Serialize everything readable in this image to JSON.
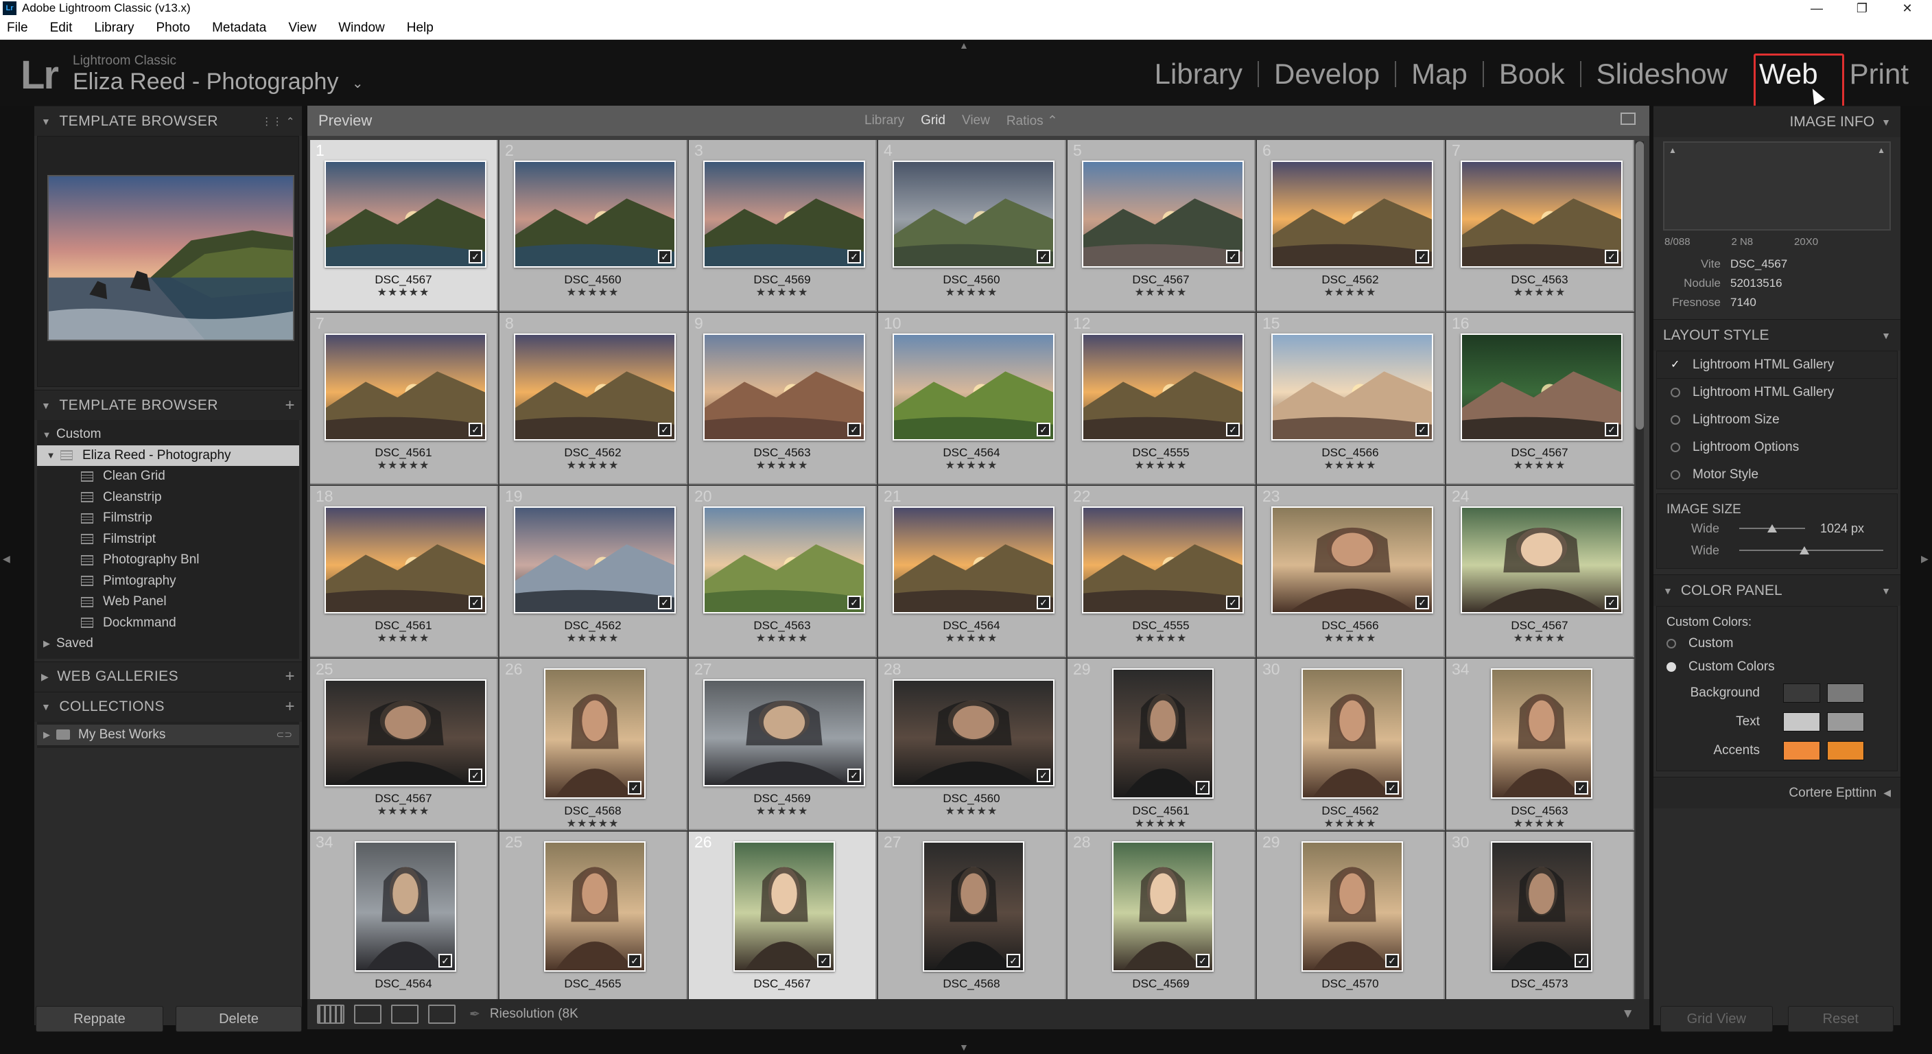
{
  "window": {
    "badge": "Lr",
    "title": "Adobe Lightroom Classic (v13.x)",
    "controls": [
      "—",
      "❐",
      "✕"
    ]
  },
  "menu": [
    "File",
    "Edit",
    "Library",
    "Photo",
    "Metadata",
    "View",
    "Window",
    "Help"
  ],
  "identity": {
    "logo": "Lr",
    "app": "Lightroom Classic",
    "catalog": "Eliza Reed - Photography"
  },
  "modules": [
    "Library",
    "Develop",
    "Map",
    "Book",
    "Slideshow",
    "Web",
    "Print"
  ],
  "active_module": "Web",
  "left_panel": {
    "preview_header": "TEMPLATE BROWSER",
    "template_header": "TEMPLATE BROWSER",
    "folders": [
      {
        "label": "Custom",
        "expanded": true
      },
      {
        "label": "Eliza Reed - Photography",
        "selected": true
      },
      {
        "label": "Clean Grid"
      },
      {
        "label": "Cleanstrip"
      },
      {
        "label": "Filmstrip"
      },
      {
        "label": "Filmstript"
      },
      {
        "label": "Photography Bnl"
      },
      {
        "label": "Pimtography"
      },
      {
        "label": "Web Panel"
      },
      {
        "label": "Dockmmand"
      },
      {
        "label": "Saved"
      }
    ],
    "web_galleries_header": "WEB GALLERIES",
    "collections_header": "COLLECTIONS",
    "collection_item": "My Best Works",
    "buttons": [
      "Reppate",
      "Delete"
    ]
  },
  "center": {
    "title": "Preview",
    "view_options": [
      "Library",
      "Grid",
      "View",
      "Ratios ⌃"
    ],
    "active_view": "Grid",
    "grid": [
      [
        {
          "num": "1",
          "name": "DSC_4567",
          "sel": true,
          "kind": "coast"
        },
        {
          "num": "2",
          "name": "DSC_4560",
          "kind": "coast"
        },
        {
          "num": "3",
          "name": "DSC_4569",
          "kind": "coast"
        },
        {
          "num": "4",
          "name": "DSC_4560",
          "kind": "mountain"
        },
        {
          "num": "5",
          "name": "DSC_4567",
          "kind": "peaks"
        },
        {
          "num": "6",
          "name": "DSC_4562",
          "kind": "sunset"
        },
        {
          "num": "7",
          "name": "DSC_4563",
          "kind": "sunset"
        }
      ],
      [
        {
          "num": "7",
          "name": "DSC_4561",
          "kind": "sunset"
        },
        {
          "num": "8",
          "name": "DSC_4562",
          "kind": "sunset"
        },
        {
          "num": "9",
          "name": "DSC_4563",
          "kind": "rocks"
        },
        {
          "num": "10",
          "name": "DSC_4564",
          "kind": "valley"
        },
        {
          "num": "12",
          "name": "DSC_4555",
          "kind": "sunset"
        },
        {
          "num": "15",
          "name": "DSC_4566",
          "kind": "beach"
        },
        {
          "num": "16",
          "name": "DSC_4567",
          "kind": "green"
        }
      ],
      [
        {
          "num": "18",
          "name": "DSC_4561",
          "kind": "sunset"
        },
        {
          "num": "19",
          "name": "DSC_4562",
          "kind": "lake"
        },
        {
          "num": "20",
          "name": "DSC_4563",
          "kind": "hills"
        },
        {
          "num": "21",
          "name": "DSC_4564",
          "kind": "sunset"
        },
        {
          "num": "22",
          "name": "DSC_4555",
          "kind": "sunset"
        },
        {
          "num": "23",
          "name": "DSC_4566",
          "kind": "portrait-warm"
        },
        {
          "num": "24",
          "name": "DSC_4567",
          "kind": "portrait-green"
        }
      ],
      [
        {
          "num": "25",
          "name": "DSC_4567",
          "kind": "portrait-dark"
        },
        {
          "num": "26",
          "name": "DSC_4568",
          "kind": "portrait-warm",
          "tall": true
        },
        {
          "num": "27",
          "name": "DSC_4569",
          "kind": "portrait-street"
        },
        {
          "num": "28",
          "name": "DSC_4560",
          "kind": "portrait-dark"
        },
        {
          "num": "29",
          "name": "DSC_4561",
          "kind": "portrait-dark",
          "tall": true
        },
        {
          "num": "30",
          "name": "DSC_4562",
          "kind": "portrait-warm",
          "tall": true
        },
        {
          "num": "34",
          "name": "DSC_4563",
          "kind": "portrait-warm",
          "tall": true
        }
      ],
      [
        {
          "num": "34",
          "name": "DSC_4564",
          "kind": "portrait-street",
          "tall": true
        },
        {
          "num": "25",
          "name": "DSC_4565",
          "kind": "portrait-warm",
          "tall": true
        },
        {
          "num": "26",
          "name": "DSC_4567",
          "sel": true,
          "kind": "portrait-green",
          "tall": true
        },
        {
          "num": "27",
          "name": "DSC_4568",
          "kind": "portrait-dark",
          "tall": true
        },
        {
          "num": "28",
          "name": "DSC_4569",
          "kind": "portrait-green",
          "tall": true
        },
        {
          "num": "29",
          "name": "DSC_4570",
          "kind": "portrait-warm",
          "tall": true
        },
        {
          "num": "30",
          "name": "DSC_4573",
          "kind": "portrait-dark",
          "tall": true
        }
      ]
    ],
    "stars": "★★★★★",
    "check": "✓",
    "bottom_label": "Riesolution (8K"
  },
  "right_panel": {
    "image_info_header": "IMAGE INFO",
    "info_meta": [
      "8/088",
      "2 N8",
      "20X0"
    ],
    "info_fields": [
      {
        "k": "Vite",
        "v": "DSC_4567"
      },
      {
        "k": "Nodule",
        "v": "52013516"
      },
      {
        "k": "Fresnose",
        "v": "7140"
      }
    ],
    "layout_header": "LAYOUT STYLE",
    "layout_checked": "Lightroom HTML Gallery",
    "layout_options": [
      "Lightroom HTML Gallery",
      "Lightroom Size",
      "Lightroom Options",
      "Motor Style"
    ],
    "image_size_header": "IMAGE SIZE",
    "sliders": [
      {
        "label": "Wide",
        "value": "1024 px",
        "level": 0.5
      },
      {
        "label": "Wide",
        "value": "",
        "level": 0.45
      }
    ],
    "color_header": "COLOR PANEL",
    "custom_colors_label": "Custom Colors:",
    "color_mode_options": [
      "Custom",
      "Custom Colors"
    ],
    "color_mode_selected": "Custom Colors",
    "color_rows": [
      {
        "label": "Background",
        "a": "#3a3a3a",
        "b": "#7a7a7a"
      },
      {
        "label": "Text",
        "a": "#c8c8c8",
        "b": "#9a9a9a"
      },
      {
        "label": "Accents",
        "a": "#f08a3a",
        "b": "#e8892a"
      }
    ],
    "collapsed_section": "Cortere Epttinn",
    "buttons": [
      "Grid View",
      "Reset"
    ]
  }
}
